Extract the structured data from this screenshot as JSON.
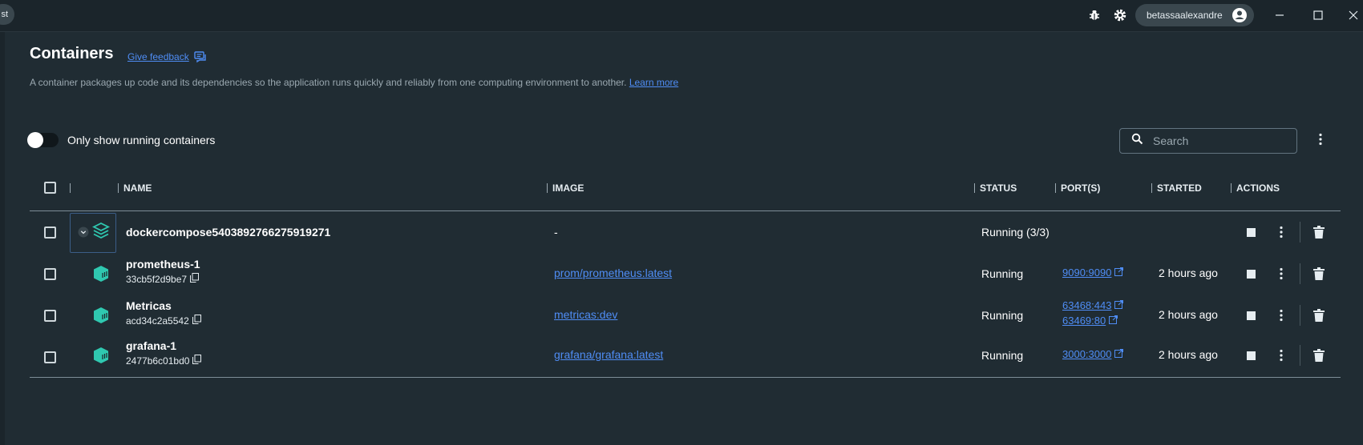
{
  "titlebar": {
    "left_tab_fragment": "st",
    "username": "betassaalexandre",
    "icons": {
      "bug": "bug-icon",
      "settings": "gear-icon",
      "avatar": "account-circle-icon"
    }
  },
  "page": {
    "title": "Containers",
    "feedback_label": "Give feedback",
    "subtitle": "A container packages up code and its dependencies so the application runs quickly and reliably from one computing environment to another.",
    "learn_more": "Learn more"
  },
  "filter": {
    "toggle_label": "Only show running containers",
    "toggle_on": false
  },
  "search": {
    "placeholder": "Search"
  },
  "table": {
    "headers": {
      "name": "NAME",
      "image": "IMAGE",
      "status": "STATUS",
      "ports": "PORT(S)",
      "started": "STARTED",
      "actions": "ACTIONS"
    },
    "group": {
      "name": "dockercompose5403892766275919271",
      "image": "-",
      "status": "Running (3/3)"
    },
    "rows": [
      {
        "name": "prometheus-1",
        "id": "33cb5f2d9be7",
        "image": "prom/prometheus:latest",
        "status": "Running",
        "ports": [
          "9090:9090"
        ],
        "started": "2 hours ago"
      },
      {
        "name": "Metricas",
        "id": "acd34c2a5542",
        "image": "metricas:dev",
        "status": "Running",
        "ports": [
          "63468:443",
          "63469:80"
        ],
        "started": "2 hours ago"
      },
      {
        "name": "grafana-1",
        "id": "2477b6c01bd0",
        "image": "grafana/grafana:latest",
        "status": "Running",
        "ports": [
          "3000:3000"
        ],
        "started": "2 hours ago"
      }
    ]
  },
  "colors": {
    "background": "#202c33",
    "titlebar": "#1b252b",
    "link": "#4f8df5",
    "container_icon": "#2fc8b0",
    "text": "#ffffff"
  }
}
